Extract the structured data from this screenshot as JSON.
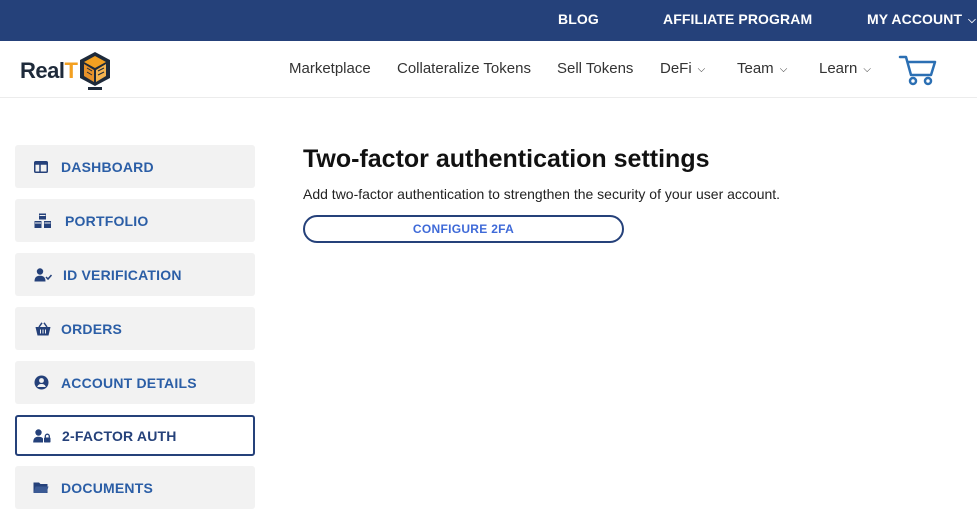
{
  "topbar": {
    "blog": "BLOG",
    "affiliate": "AFFILIATE PROGRAM",
    "account": "MY ACCOUNT",
    "background": "#25417a"
  },
  "logo": {
    "text_main": "Real",
    "text_accent": "T"
  },
  "nav": {
    "marketplace": "Marketplace",
    "collateralize": "Collateralize Tokens",
    "sell": "Sell Tokens",
    "defi": "DeFi",
    "team": "Team",
    "learn": "Learn",
    "cart_icon": "cart-icon"
  },
  "sidebar": {
    "items": [
      {
        "label": "DASHBOARD",
        "icon": "dashboard-icon"
      },
      {
        "label": "PORTFOLIO",
        "icon": "cubes-icon"
      },
      {
        "label": "ID VERIFICATION",
        "icon": "user-check-icon"
      },
      {
        "label": "ORDERS",
        "icon": "basket-icon"
      },
      {
        "label": "ACCOUNT DETAILS",
        "icon": "user-circle-icon"
      },
      {
        "label": "2-FACTOR AUTH",
        "icon": "user-lock-icon",
        "active": true
      },
      {
        "label": "DOCUMENTS",
        "icon": "folder-icon"
      }
    ]
  },
  "main": {
    "title": "Two-factor authentication settings",
    "description": "Add two-factor authentication to strengthen the security of your user account.",
    "configure_button": "CONFIGURE 2FA"
  },
  "colors": {
    "brand_navy": "#25417a",
    "link_blue": "#2b5ea6",
    "accent_orange": "#f3a021"
  }
}
